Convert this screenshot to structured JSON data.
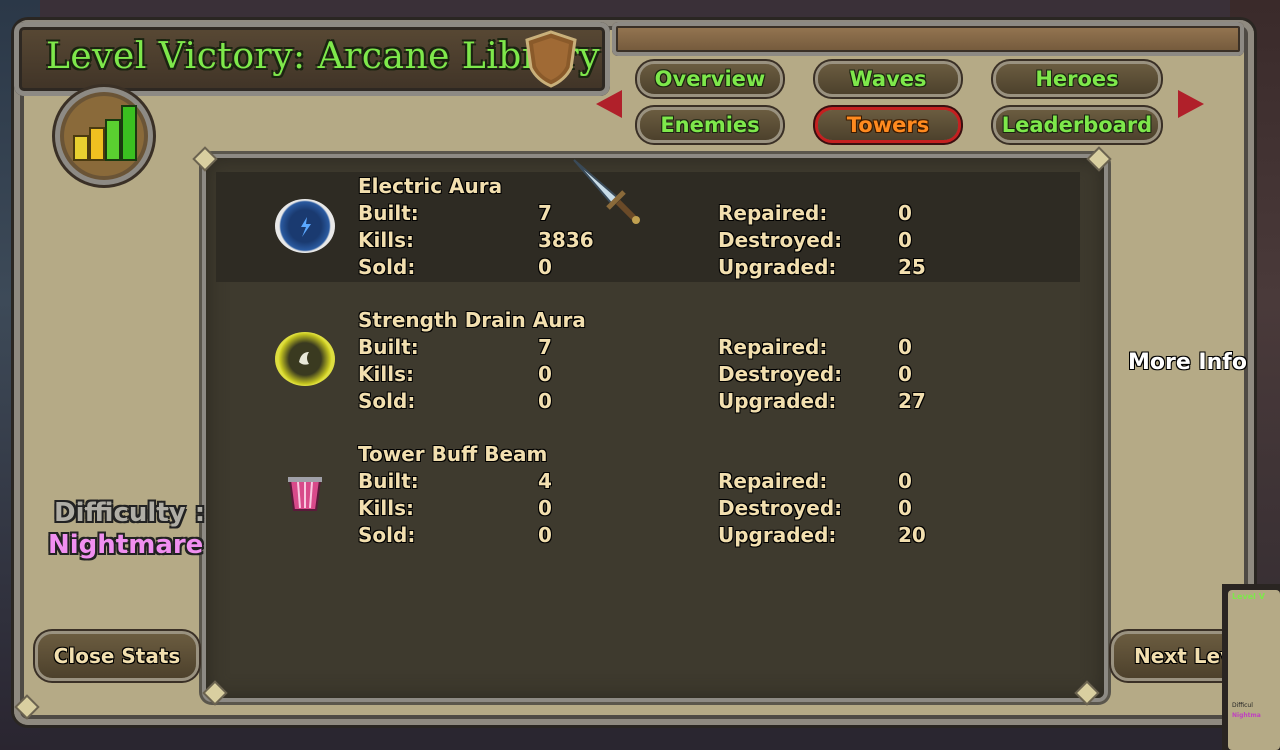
{
  "title": "Level Victory: Arcane Library",
  "tabs": [
    {
      "label": "Overview",
      "active": false
    },
    {
      "label": "Waves",
      "active": false
    },
    {
      "label": "Heroes",
      "active": false
    },
    {
      "label": "Enemies",
      "active": false
    },
    {
      "label": "Towers",
      "active": true
    },
    {
      "label": "Leaderboard",
      "active": false
    }
  ],
  "labels": {
    "built": "Built:",
    "kills": "Kills:",
    "sold": "Sold:",
    "repaired": "Repaired:",
    "destroyed": "Destroyed:",
    "upgraded": "Upgraded:"
  },
  "towers": [
    {
      "name": "Electric Aura",
      "icon": "electric-aura-icon",
      "built": "7",
      "kills": "3836",
      "sold": "0",
      "repaired": "0",
      "destroyed": "0",
      "upgraded": "25"
    },
    {
      "name": "Strength Drain Aura",
      "icon": "strength-drain-aura-icon",
      "built": "7",
      "kills": "0",
      "sold": "0",
      "repaired": "0",
      "destroyed": "0",
      "upgraded": "27"
    },
    {
      "name": "Tower Buff Beam",
      "icon": "tower-buff-beam-icon",
      "built": "4",
      "kills": "0",
      "sold": "0",
      "repaired": "0",
      "destroyed": "0",
      "upgraded": "20"
    }
  ],
  "more_info": "More Info",
  "difficulty_label": "Difficulty :",
  "difficulty_value": "Nightmare",
  "buttons": {
    "close_stats": "Close Stats",
    "next_level": "Next Leve"
  },
  "mini_preview": {
    "title": "Level V",
    "difficulty": "Difficul",
    "value": "Nightma"
  },
  "colors": {
    "title_green": "#7ee84b",
    "active_tab_orange": "#ff8a1f",
    "active_tab_border": "#c42020",
    "difficulty_pink": "#f08ff0"
  }
}
